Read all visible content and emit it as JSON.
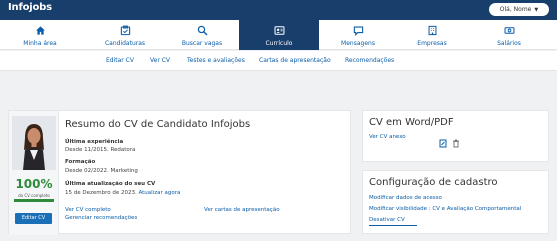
{
  "topbar": {
    "logo": "Infojobs",
    "user_label": "Olá, Nome",
    "user_chevron": "▼"
  },
  "mainnav": [
    {
      "label": "Minha área",
      "icon": "home-icon"
    },
    {
      "label": "Candidaturas",
      "icon": "briefcase-icon"
    },
    {
      "label": "Buscar vagas",
      "icon": "search-icon"
    },
    {
      "label": "Currículo",
      "icon": "id-card-icon",
      "active": true
    },
    {
      "label": "Mensagens",
      "icon": "chat-icon"
    },
    {
      "label": "Empresas",
      "icon": "building-icon"
    },
    {
      "label": "Salários",
      "icon": "money-icon"
    }
  ],
  "subnav": [
    "Editar CV",
    "Ver CV",
    "Testes e avaliações",
    "Cartas de apresentação",
    "Recomendações"
  ],
  "summary": {
    "title": "Resumo do CV de Candidato Infojobs",
    "experience_label": "Última experiência",
    "experience_value": "Desde 11/2015. Redatora",
    "education_label": "Formação",
    "education_value": "Desde 02/2022. Marketing",
    "update_label": "Última atualização do seu CV",
    "update_value": "15 de Dezembro de 2023.",
    "update_link": "Atualizar agora",
    "link_view_cv": "Ver CV completo",
    "link_recommendations": "Gerenciar recomendações",
    "link_letters": "Ver cartas de apresentação"
  },
  "profile": {
    "completion": 100,
    "completion_text": "100%",
    "completion_label": "do CV completo",
    "edit_button": "Editar CV"
  },
  "cv_word": {
    "title": "CV em Word/PDF",
    "link": "Ver CV anexo"
  },
  "config": {
    "title": "Configuração de cadastro",
    "links": [
      "Modificar dados de acesso",
      "Modificar visibilidade : CV e Avaliação Comportamental",
      "Desativar CV"
    ]
  },
  "colors": {
    "navy": "#183e6b",
    "link": "#0a5da8",
    "green": "#2e8b3a",
    "button": "#1a6fb6"
  }
}
